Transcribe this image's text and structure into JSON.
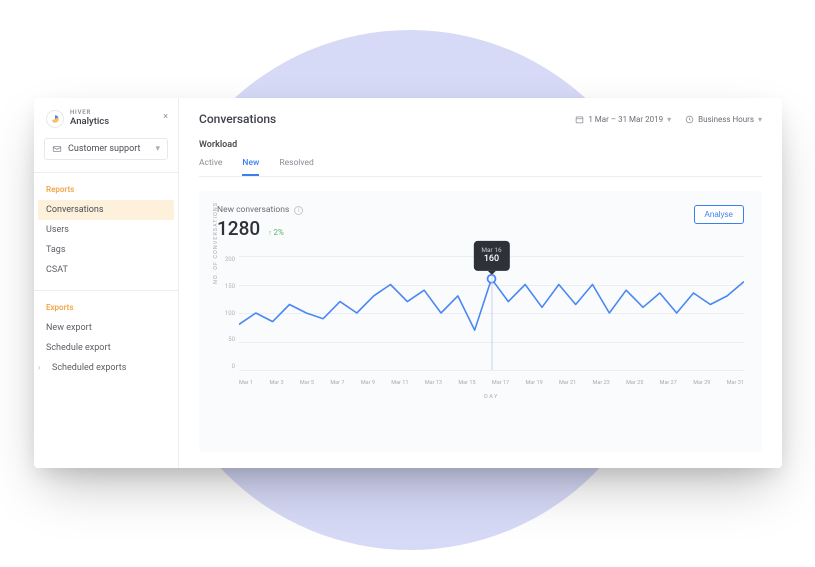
{
  "sidebar": {
    "brand_small": "HIVER",
    "brand_big": "Analytics",
    "selector": {
      "label": "Customer support"
    },
    "sections": [
      {
        "title": "Reports",
        "items": [
          {
            "label": "Conversations",
            "active": true
          },
          {
            "label": "Users"
          },
          {
            "label": "Tags"
          },
          {
            "label": "CSAT"
          }
        ]
      },
      {
        "title": "Exports",
        "items": [
          {
            "label": "New export"
          },
          {
            "label": "Schedule export"
          },
          {
            "label": "Scheduled exports",
            "has_children": true
          }
        ]
      }
    ]
  },
  "header": {
    "title": "Conversations",
    "date_range": "1 Mar – 31 Mar 2019",
    "hours_filter": "Business Hours"
  },
  "workload": {
    "subtitle": "Workload",
    "tabs": [
      {
        "label": "Active"
      },
      {
        "label": "New",
        "active": true
      },
      {
        "label": "Resolved"
      }
    ]
  },
  "chart": {
    "title": "New conversations",
    "metric": "1280",
    "delta": "2%",
    "analyse_label": "Analyse",
    "ylabel": "NO. OF CONVERSATIONS",
    "xlabel": "DAY",
    "y_ticks": [
      "200",
      "150",
      "100",
      "50",
      "0"
    ],
    "x_ticks": [
      "Mar 1",
      "Mar 3",
      "Mar 5",
      "Mar 7",
      "Mar 9",
      "Mar 11",
      "Mar 13",
      "Mar 15",
      "Mar 17",
      "Mar 19",
      "Mar 21",
      "Mar 23",
      "Mar 25",
      "Mar 27",
      "Mar 29",
      "Mar 31"
    ],
    "tooltip": {
      "date": "Mar 16",
      "value": "160"
    }
  },
  "chart_data": {
    "type": "line",
    "title": "New conversations",
    "xlabel": "DAY",
    "ylabel": "NO. OF CONVERSATIONS",
    "ylim": [
      0,
      200
    ],
    "x": [
      "Mar 1",
      "Mar 2",
      "Mar 3",
      "Mar 4",
      "Mar 5",
      "Mar 6",
      "Mar 7",
      "Mar 8",
      "Mar 9",
      "Mar 10",
      "Mar 11",
      "Mar 12",
      "Mar 13",
      "Mar 14",
      "Mar 15",
      "Mar 16",
      "Mar 17",
      "Mar 18",
      "Mar 19",
      "Mar 20",
      "Mar 21",
      "Mar 22",
      "Mar 23",
      "Mar 24",
      "Mar 25",
      "Mar 26",
      "Mar 27",
      "Mar 28",
      "Mar 29",
      "Mar 30",
      "Mar 31"
    ],
    "values": [
      80,
      100,
      85,
      115,
      100,
      90,
      120,
      100,
      130,
      150,
      120,
      140,
      100,
      130,
      70,
      160,
      120,
      150,
      110,
      150,
      115,
      150,
      100,
      140,
      110,
      135,
      100,
      135,
      115,
      130,
      155
    ],
    "highlight_index": 15
  }
}
